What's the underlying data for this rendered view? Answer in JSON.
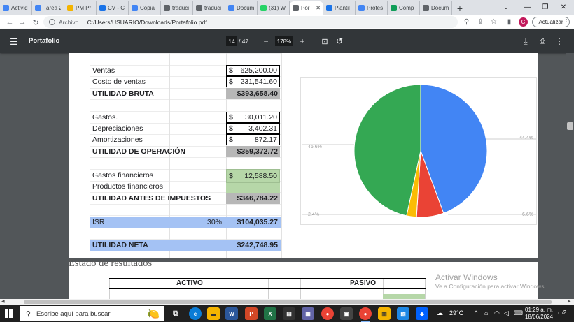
{
  "browser": {
    "tabs": [
      {
        "label": "Activid",
        "color": "#4285f4"
      },
      {
        "label": "Tarea 2",
        "color": "#4285f4"
      },
      {
        "label": "PM Pr",
        "color": "#f4b400"
      },
      {
        "label": "CV - C",
        "color": "#1a73e8"
      },
      {
        "label": "Copia",
        "color": "#4285f4"
      },
      {
        "label": "traduci",
        "color": "#5f6368"
      },
      {
        "label": "traduci",
        "color": "#5f6368"
      },
      {
        "label": "Docum",
        "color": "#4285f4"
      },
      {
        "label": "(31) W",
        "color": "#25d366"
      },
      {
        "label": "Por",
        "color": "#5f6368",
        "active": true
      },
      {
        "label": "Plantil",
        "color": "#1a73e8"
      },
      {
        "label": "Profes",
        "color": "#4285f4"
      },
      {
        "label": "Comp",
        "color": "#0f9d58"
      },
      {
        "label": "Docum",
        "color": "#5f6368"
      }
    ],
    "address": {
      "scheme": "Archivo",
      "url": "C:/Users/USUARIO/Downloads/Portafolio.pdf"
    },
    "profile_initial": "C",
    "update_label": "Actualizar"
  },
  "pdf": {
    "title": "Portafolio",
    "page_current": "14",
    "page_total": "/ 47",
    "zoom": "178%"
  },
  "statement": {
    "rows": {
      "ventas": {
        "label": "Ventas",
        "currency": "$",
        "value": "625,200.00"
      },
      "costo": {
        "label": "Costo de ventas",
        "currency": "$",
        "value": "231,541.60"
      },
      "utilidad_bruta": {
        "label": "UTILIDAD BRUTA",
        "value": "$393,658.40"
      },
      "gastos": {
        "label": "Gastos.",
        "currency": "$",
        "value": "30,011.20"
      },
      "depreciaciones": {
        "label": "Depreciaciones",
        "currency": "$",
        "value": "3,402.31"
      },
      "amortizaciones": {
        "label": "Amortizaciones",
        "currency": "$",
        "value": "872.17"
      },
      "utilidad_operacion": {
        "label": "UTILIDAD DE OPERACIÓN",
        "value": "$359,372.72"
      },
      "gastos_financieros": {
        "label": "Gastos financieros",
        "currency": "$",
        "value": "12,588.50"
      },
      "productos_financieros": {
        "label": "Productos financieros"
      },
      "utilidad_antes": {
        "label": "UTILIDAD ANTES DE IMPUESTOS",
        "value": "$346,784.22"
      },
      "isr": {
        "label": "ISR",
        "pct": "30%",
        "value": "$104,035.27"
      },
      "utilidad_neta": {
        "label": "UTILIDAD NETA",
        "value": "$242,748.95"
      }
    }
  },
  "chart_data": {
    "type": "pie",
    "slices": [
      {
        "label": "44.4%",
        "value": 44.4,
        "color": "#4285f4"
      },
      {
        "label": "6.6%",
        "value": 6.6,
        "color": "#ea4335"
      },
      {
        "label": "2.4%",
        "value": 2.4,
        "color": "#fbbc04"
      },
      {
        "label": "46.6%",
        "value": 46.6,
        "color": "#34a853"
      }
    ]
  },
  "page2": {
    "heading": "Estado de resultados",
    "col_activo": "ACTIVO",
    "col_pasivo": "PASIVO",
    "watermark_title": "Activar Windows",
    "watermark_sub": "Ve a Configuración para activar Windows."
  },
  "taskbar": {
    "search_placeholder": "Escribe aquí para buscar",
    "weather": "29°C",
    "time": "01:29 a. m.",
    "date": "18/06/2024",
    "notif_count": "2"
  }
}
